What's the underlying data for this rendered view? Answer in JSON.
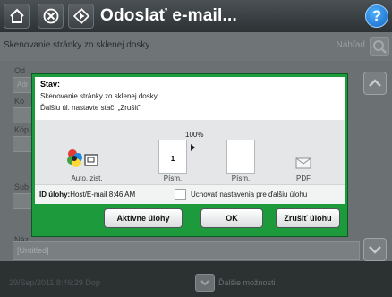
{
  "titlebar": {
    "title": "Odoslať e-mail...",
    "help_label": "?"
  },
  "background": {
    "subtitle": "Skenovanie stránky zo sklenej dosky",
    "preview_label": "Náhľad",
    "labels": [
      "Od",
      "Ko",
      "Kóp",
      "Sub",
      "Náz"
    ],
    "field_value": "Adr",
    "untitled_value": "[Untitled]",
    "timestamp": "29/Sep/2011 8:46:29 Dop",
    "more_options": "Ďalšie možnosti"
  },
  "dialog": {
    "status_title": "Stav:",
    "status_line1": "Skenovanie stránky zo sklenej dosky",
    "status_line2": "Ďalšiu úl. nastavte stač. „Zrušiť\"",
    "progress_percent": "100%",
    "source_label": "Auto. zist.",
    "page_number": "1",
    "page_label_1": "Písm.",
    "page_label_2": "Písm.",
    "pdf_label": "PDF",
    "job_id_label": "ID úlohy:",
    "job_id_value": "Host/E-mail 8:46 AM",
    "keep_settings_label": "Uchovať nastavenia pre ďalšiu úlohu",
    "keep_settings_checked": false,
    "buttons": {
      "active_jobs": "Aktívne úlohy",
      "ok": "OK",
      "cancel_job": "Zrušiť úlohu"
    }
  },
  "colors": {
    "accent": "#1d9a3c",
    "titlebar": "#2d3234"
  }
}
